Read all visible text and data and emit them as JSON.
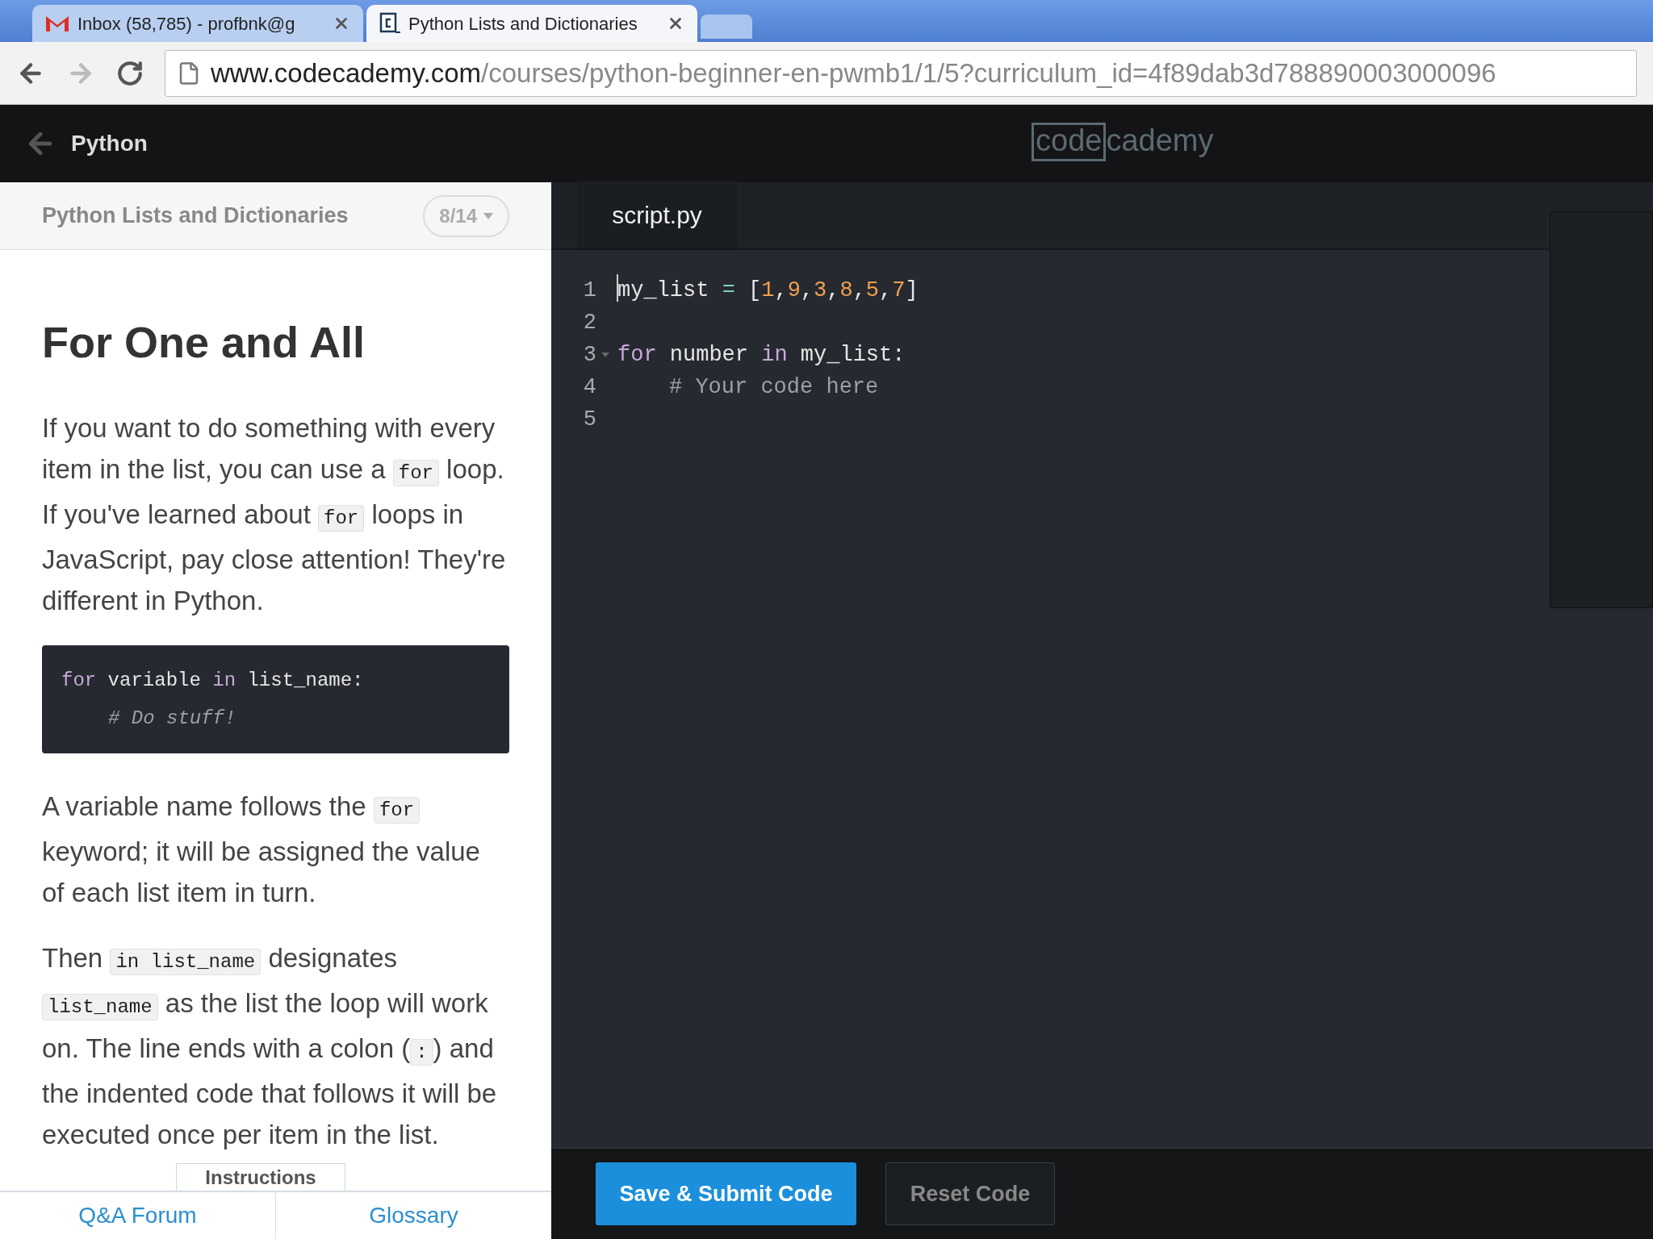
{
  "browser": {
    "tabs": [
      {
        "title": "Inbox (58,785) - profbnk@g",
        "selected": false
      },
      {
        "title": "Python Lists and Dictionaries",
        "selected": true
      }
    ],
    "url_host": "www.codecademy.com",
    "url_path": "/courses/python-beginner-en-pwmb1/1/5?curriculum_id=4f89dab3d788890003000096"
  },
  "header": {
    "back_label": "Python",
    "logo_box": "code",
    "logo_rest": "cademy"
  },
  "lesson": {
    "course": "Python Lists and Dictionaries",
    "progress": "8/14",
    "title": "For One and All",
    "blocks": [
      {
        "kind": "paragraph",
        "parts": [
          {
            "kind": "text",
            "text": "If you want to do something with every item in the list, you can use a "
          },
          {
            "kind": "code",
            "text": "for"
          },
          {
            "kind": "text",
            "text": " loop. If you've learned about "
          },
          {
            "kind": "code",
            "text": "for"
          },
          {
            "kind": "text",
            "text": " loops in JavaScript, pay close attention! They're different in Python."
          }
        ]
      },
      {
        "kind": "codeblock",
        "lines": [
          {
            "indented": false,
            "tokens": [
              {
                "kind": "keyword",
                "text": "for"
              },
              {
                "kind": "plain",
                "text": " variable "
              },
              {
                "kind": "keyword",
                "text": "in"
              },
              {
                "kind": "plain",
                "text": " list_name:"
              }
            ]
          },
          {
            "indented": true,
            "tokens": [
              {
                "kind": "comment",
                "text": "# Do stuff!"
              }
            ]
          }
        ]
      },
      {
        "kind": "paragraph",
        "parts": [
          {
            "kind": "text",
            "text": "A variable name follows the "
          },
          {
            "kind": "code",
            "text": "for"
          },
          {
            "kind": "text",
            "text": " keyword; it will be assigned the value of each list item in turn."
          }
        ]
      },
      {
        "kind": "paragraph",
        "parts": [
          {
            "kind": "text",
            "text": "Then "
          },
          {
            "kind": "code",
            "text": "in list_name"
          },
          {
            "kind": "text",
            "text": " designates "
          },
          {
            "kind": "code",
            "text": "list_name"
          },
          {
            "kind": "text",
            "text": " as the list the loop will work on. The line ends with a colon ("
          },
          {
            "kind": "code",
            "text": ":"
          },
          {
            "kind": "text",
            "text": ") and the indented code that follows it will be executed once per item in the list."
          }
        ]
      }
    ],
    "instructions_tab": "Instructions",
    "nav": [
      "Q&A Forum",
      "Glossary"
    ]
  },
  "editor": {
    "file_tab": "script.py",
    "lines": [
      {
        "number": "1",
        "foldable": false,
        "cursor": true,
        "indented": false,
        "tokens": [
          {
            "kind": "plain",
            "text": "my_list "
          },
          {
            "kind": "operator",
            "text": "="
          },
          {
            "kind": "plain",
            "text": " ["
          },
          {
            "kind": "number",
            "text": "1"
          },
          {
            "kind": "plain",
            "text": ","
          },
          {
            "kind": "number",
            "text": "9"
          },
          {
            "kind": "plain",
            "text": ","
          },
          {
            "kind": "number",
            "text": "3"
          },
          {
            "kind": "plain",
            "text": ","
          },
          {
            "kind": "number",
            "text": "8"
          },
          {
            "kind": "plain",
            "text": ","
          },
          {
            "kind": "number",
            "text": "5"
          },
          {
            "kind": "plain",
            "text": ","
          },
          {
            "kind": "number",
            "text": "7"
          },
          {
            "kind": "plain",
            "text": "]"
          }
        ]
      },
      {
        "number": "2",
        "foldable": false,
        "cursor": false
      },
      {
        "number": "3",
        "foldable": true,
        "cursor": false,
        "indented": false,
        "tokens": [
          {
            "kind": "keyword",
            "text": "for"
          },
          {
            "kind": "plain",
            "text": " number "
          },
          {
            "kind": "keyword",
            "text": "in"
          },
          {
            "kind": "plain",
            "text": " my_list:"
          }
        ]
      },
      {
        "number": "4",
        "foldable": false,
        "cursor": false,
        "indented": true,
        "tokens": [
          {
            "kind": "comment",
            "text": "# Your code here"
          }
        ]
      },
      {
        "number": "5",
        "foldable": false,
        "cursor": false
      }
    ],
    "buttons": [
      {
        "label": "Save & Submit Code",
        "kind": "primary"
      },
      {
        "label": "Reset Code",
        "kind": "secondary"
      }
    ]
  }
}
